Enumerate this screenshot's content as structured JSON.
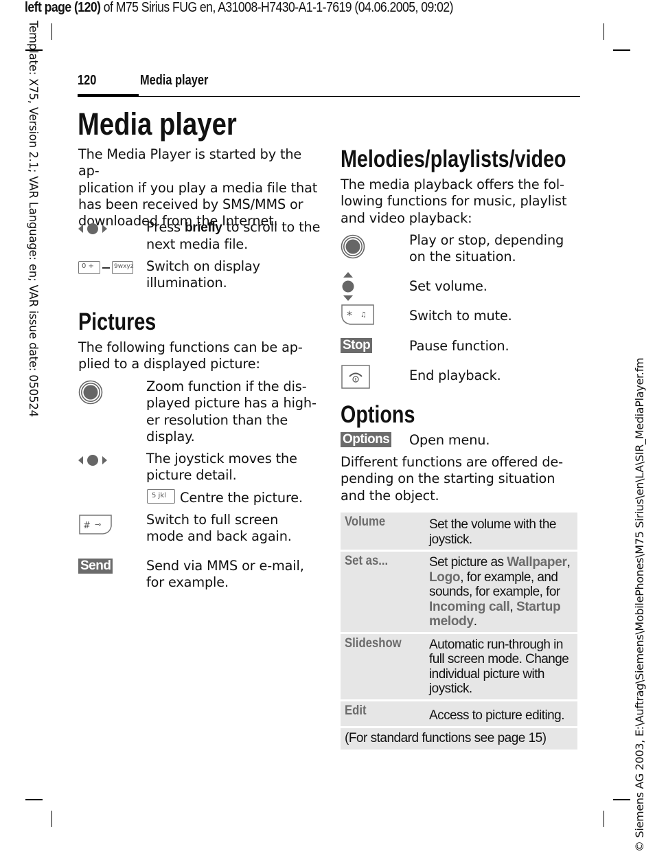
{
  "print_header": {
    "bold_part": "left page (120)",
    "rest": " of M75 Sirius FUG en, A31008-H7430-A1-1-7619 (04.06.2005, 09:02)"
  },
  "side_left": "Template: X75, Version 2.1; VAR Language: en; VAR issue date: 050524",
  "side_right": "© Siemens AG 2003, E:\\Auftrag\\Siemens\\MobilePhones\\M75 Sirius\\en\\LA\\SIR_MediaPlayer.fm",
  "running_header": {
    "page_number": "120",
    "title": "Media player"
  },
  "main": {
    "title": "Media player",
    "intro": "The Media Player is started by the ap-plication if you play a media file that has been received by SMS/MMS or downloaded from the Internet.",
    "intro_lines": [
      "The Media Player is started by the ap-",
      "plication if you play a media file that",
      "has been received by SMS/MMS or",
      "downloaded from the Internet."
    ],
    "items": [
      {
        "icon": "joystick-left-right-icon",
        "pre": "Press ",
        "bold": "briefly",
        "post_lines": [
          " to scroll to the",
          "next media file."
        ]
      },
      {
        "icon": "keys-0-to-9-icon",
        "key_from": "0 +",
        "key_to": "9wxyz",
        "lines": [
          "Switch on display",
          "illumination."
        ]
      }
    ]
  },
  "pictures": {
    "heading": "Pictures",
    "intro_lines": [
      "The following functions can be ap-",
      "plied to a displayed picture:"
    ],
    "items": [
      {
        "icon": "joystick-press-icon",
        "lines": [
          "Zoom function if the dis-",
          "played picture has a high-",
          "er resolution than the",
          "display."
        ]
      },
      {
        "icon": "joystick-left-right-icon",
        "lines": [
          "The joystick moves the",
          "picture detail."
        ]
      },
      {
        "icon": "key-5-icon",
        "key_label": "5 jkl",
        "text": "Centre the picture."
      },
      {
        "icon": "key-hash-icon",
        "key_label": "# ⊸",
        "lines": [
          "Switch to full screen",
          "mode and back again."
        ]
      },
      {
        "icon": "softkey-send",
        "softkey": "Send",
        "lines": [
          "Send via MMS or e-mail,",
          "for example."
        ]
      }
    ]
  },
  "melodies": {
    "heading": "Melodies/playlists/video",
    "intro_lines": [
      "The media playback offers the fol-",
      "lowing functions for music, playlist",
      "and video playback:"
    ],
    "items": [
      {
        "icon": "joystick-press-icon",
        "lines": [
          "Play or stop, depending",
          "on the situation."
        ]
      },
      {
        "icon": "joystick-up-down-icon",
        "lines": [
          "Set volume."
        ]
      },
      {
        "icon": "key-star-icon",
        "key_label": "* ♫",
        "lines": [
          "Switch to mute."
        ]
      },
      {
        "icon": "softkey-stop",
        "softkey": "Stop",
        "lines": [
          "Pause function."
        ]
      },
      {
        "icon": "end-call-key-icon",
        "lines": [
          "End playback."
        ]
      }
    ]
  },
  "options": {
    "heading": "Options",
    "softkey": "Options",
    "softkey_desc": "Open menu.",
    "text_lines": [
      "Different functions are offered de-",
      "pending on the starting situation",
      "and the object."
    ],
    "table": [
      {
        "key": "Volume",
        "value_html_parts": [
          [
            "t",
            "Set the volume with the joystick."
          ]
        ]
      },
      {
        "key": "Set as...",
        "value_html_parts": [
          [
            "t",
            "Set picture as "
          ],
          [
            "h",
            "Wallpaper"
          ],
          [
            "t",
            ", "
          ],
          [
            "h",
            "Logo"
          ],
          [
            "t",
            ", for example, and sounds, for example, for "
          ],
          [
            "h",
            "Incoming call"
          ],
          [
            "t",
            ", "
          ],
          [
            "h",
            "Startup melody"
          ],
          [
            "t",
            "."
          ]
        ]
      },
      {
        "key": "Slideshow",
        "value_html_parts": [
          [
            "t",
            "Automatic run-through in full screen mode. Change individual picture with joystick."
          ]
        ]
      },
      {
        "key": "Edit",
        "value_html_parts": [
          [
            "t",
            "Access to picture editing."
          ]
        ]
      }
    ],
    "footer": "(For standard functions see page 15)"
  },
  "colors": {
    "softkey_bg": "#6b6b6b",
    "table_bg": "#e6e6e6",
    "highlight_text": "#6b6b6b"
  }
}
